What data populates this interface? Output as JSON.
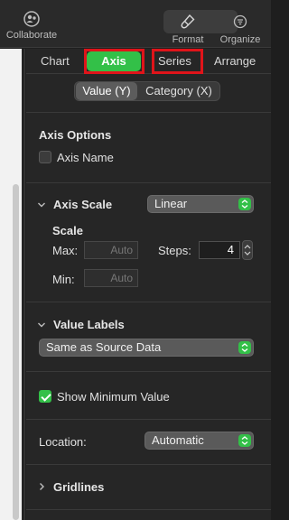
{
  "toolbar": {
    "collaborate_label": "Collaborate",
    "format_label": "Format",
    "organize_label": "Organize",
    "collaborate_icon": "collaborate-icon",
    "format_icon": "paintbrush-icon",
    "organize_icon": "organize-icon"
  },
  "tabs": {
    "chart": "Chart",
    "axis": "Axis",
    "series": "Series",
    "arrange": "Arrange",
    "selected": "Axis"
  },
  "axis_selector": {
    "value": "Value (Y)",
    "category": "Category (X)",
    "selected": "Value (Y)"
  },
  "axis_options": {
    "title": "Axis Options",
    "axis_name_label": "Axis Name",
    "axis_name_checked": false
  },
  "axis_scale": {
    "title": "Axis Scale",
    "scale_value": "Linear",
    "scale_heading": "Scale",
    "max_label": "Max:",
    "max_placeholder": "Auto",
    "min_label": "Min:",
    "min_placeholder": "Auto",
    "steps_label": "Steps:",
    "steps_value": "4"
  },
  "value_labels": {
    "title": "Value Labels",
    "format_value": "Same as Source Data",
    "show_minimum_label": "Show Minimum Value",
    "show_minimum_checked": true,
    "location_label": "Location:",
    "location_value": "Automatic"
  },
  "gridlines": {
    "title": "Gridlines"
  },
  "colors": {
    "accent": "#33c048",
    "highlight": "#e0141a"
  }
}
